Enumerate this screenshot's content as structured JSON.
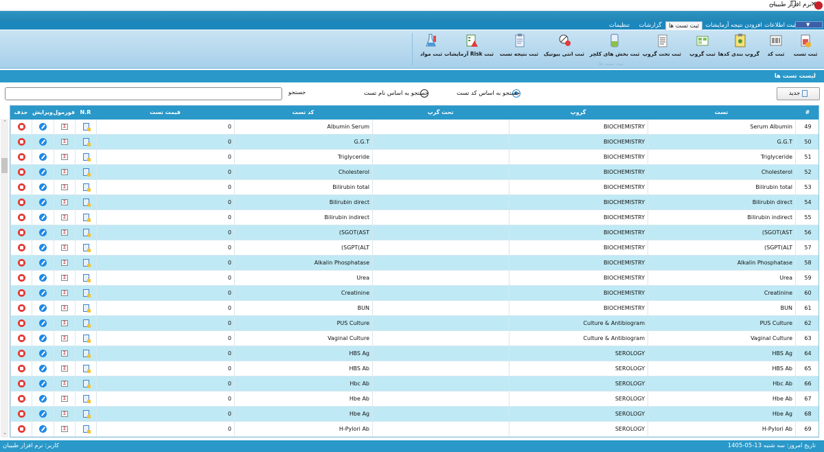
{
  "window": {
    "title": "نرم افزار طبیبان",
    "controls": [
      "—",
      "❐",
      "✕"
    ]
  },
  "tabs": [
    "ثبت اطلاعات",
    "افزودن نتیجه آزمایشات",
    "ثبت تست ها",
    "گزارشات",
    "تنظیمات"
  ],
  "active_tab": "ثبت تست ها",
  "ribbon": {
    "buttons": [
      "ثبت تست",
      "ثبت کد",
      "گروپ بندی کدها",
      "ثبت گروپ",
      "ثبت تحت گروپ",
      "ثبت بخش های کلچر",
      "ثبت انتی بیوتیک",
      "ثبت نتیجه تست",
      "ثبت Risk آزمایشات",
      "ثبت مواد"
    ],
    "group_label": "ثبت تست ها"
  },
  "section_title": "لیست تست ها",
  "toolbar": {
    "new_label": "جدید",
    "radio_by_code": "جستجو به اساس کد تست",
    "radio_by_name": "جستجو به اساس نام تست",
    "search_label": "جستجو",
    "search_value": ""
  },
  "grid": {
    "headers": [
      "#",
      "تست",
      "گروپ",
      "تحت گرپ",
      "کد تست",
      "قیمت تست",
      "N.R",
      "فورمول",
      "ویرایش",
      "حذف"
    ],
    "rows": [
      {
        "num": "49",
        "test": "Serum Albumin",
        "group": "BIOCHEMISTRY",
        "subgroup": "",
        "code": "Albumin Serum",
        "price": "0"
      },
      {
        "num": "50",
        "test": "G.G.T",
        "group": "BIOCHEMISTRY",
        "subgroup": "",
        "code": "G.G.T",
        "price": "0"
      },
      {
        "num": "51",
        "test": "Triglyceride",
        "group": "BIOCHEMISTRY",
        "subgroup": "",
        "code": "Triglyceride",
        "price": "0"
      },
      {
        "num": "52",
        "test": "Cholesterol",
        "group": "BIOCHEMISTRY",
        "subgroup": "",
        "code": "Cholesterol",
        "price": "0"
      },
      {
        "num": "53",
        "test": "Bilirubin total",
        "group": "BIOCHEMISTRY",
        "subgroup": "",
        "code": "Bilirubin total",
        "price": "0"
      },
      {
        "num": "54",
        "test": "Bilirubin direct",
        "group": "BIOCHEMISTRY",
        "subgroup": "",
        "code": "Bilirubin direct",
        "price": "0"
      },
      {
        "num": "55",
        "test": "Bilirubin indirect",
        "group": "BIOCHEMISTRY",
        "subgroup": "",
        "code": "Bilirubin indirect",
        "price": "0"
      },
      {
        "num": "56",
        "test": "(SGOT(AST",
        "group": "BIOCHEMISTRY",
        "subgroup": "",
        "code": "(SGOT(AST",
        "price": "0"
      },
      {
        "num": "57",
        "test": "(SGPT(ALT",
        "group": "BIOCHEMISTRY",
        "subgroup": "",
        "code": "(SGPT(ALT",
        "price": "0"
      },
      {
        "num": "58",
        "test": "Alkalin Phosphatase",
        "group": "BIOCHEMISTRY",
        "subgroup": "",
        "code": "Alkalin Phosphatase",
        "price": "0"
      },
      {
        "num": "59",
        "test": "Urea",
        "group": "BIOCHEMISTRY",
        "subgroup": "",
        "code": "Urea",
        "price": "0"
      },
      {
        "num": "60",
        "test": "Creatinine",
        "group": "BIOCHEMISTRY",
        "subgroup": "",
        "code": "Creatinine",
        "price": "0"
      },
      {
        "num": "61",
        "test": "BUN",
        "group": "BIOCHEMISTRY",
        "subgroup": "",
        "code": "BUN",
        "price": "0"
      },
      {
        "num": "62",
        "test": "PUS Culture",
        "group": "Culture & Antibiogram",
        "subgroup": "",
        "code": "PUS Culture",
        "price": "0"
      },
      {
        "num": "63",
        "test": "Vaginal Culture",
        "group": "Culture & Antibiogram",
        "subgroup": "",
        "code": "Vaginal Culture",
        "price": "0"
      },
      {
        "num": "64",
        "test": "HBS Ag",
        "group": "SEROLOGY",
        "subgroup": "",
        "code": "HBS Ag",
        "price": "0"
      },
      {
        "num": "65",
        "test": "HBS Ab",
        "group": "SEROLOGY",
        "subgroup": "",
        "code": "HBS Ab",
        "price": "0"
      },
      {
        "num": "66",
        "test": "Hbc Ab",
        "group": "SEROLOGY",
        "subgroup": "",
        "code": "Hbc Ab",
        "price": "0"
      },
      {
        "num": "67",
        "test": "Hbe Ab",
        "group": "SEROLOGY",
        "subgroup": "",
        "code": "Hbe Ab",
        "price": "0"
      },
      {
        "num": "68",
        "test": "Hbe Ag",
        "group": "SEROLOGY",
        "subgroup": "",
        "code": "Hbe Ag",
        "price": "0"
      },
      {
        "num": "69",
        "test": "H-Pylori Ab",
        "group": "SEROLOGY",
        "subgroup": "",
        "code": "H-Pylori Ab",
        "price": "0"
      }
    ]
  },
  "status": {
    "user": "کاربر: نرم افزار طبیبان",
    "date": "تاریخ امروز: سه شنبه  13-05-1405"
  },
  "colors": {
    "accent": "#2a98c8",
    "alt_row": "#bfe9f4",
    "delete": "#e53935",
    "edit": "#1e88e5"
  },
  "icons": {
    "delete": "trash-icon",
    "edit": "pencil-icon",
    "formula": "formula-icon",
    "nr": "document-icon"
  }
}
